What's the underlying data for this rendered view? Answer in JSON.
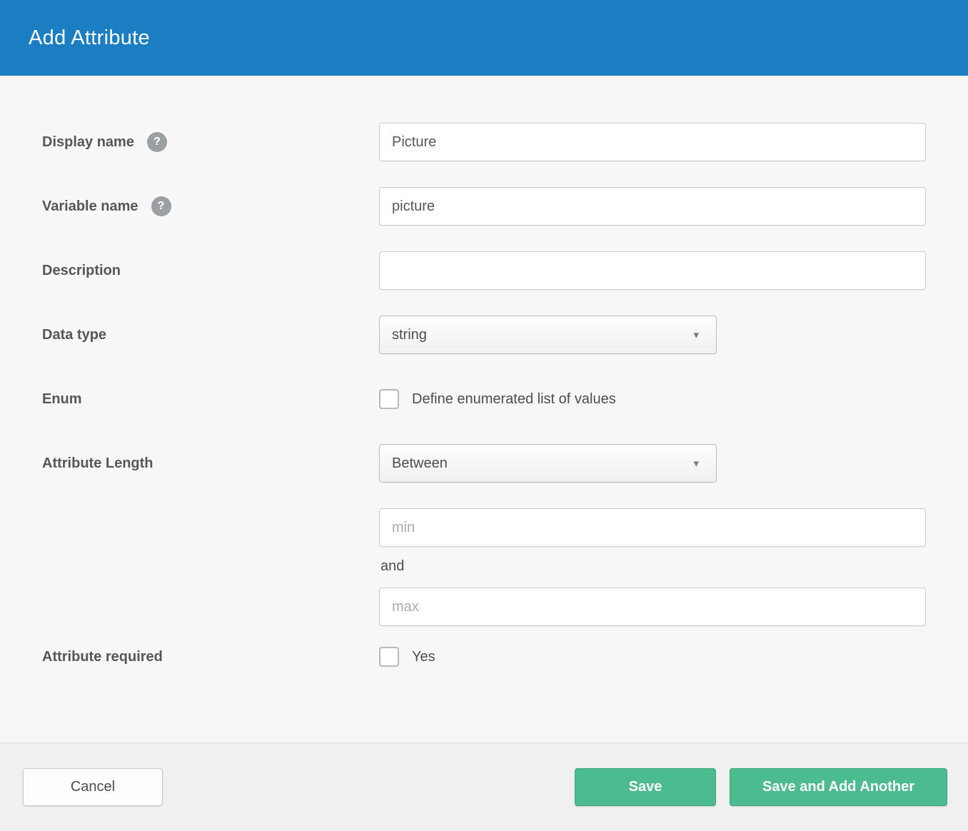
{
  "dialog": {
    "title": "Add Attribute"
  },
  "icons": {
    "help_glyph": "?",
    "caret_glyph": "▾"
  },
  "form": {
    "display_name": {
      "label": "Display name",
      "value": "Picture"
    },
    "variable_name": {
      "label": "Variable name",
      "value": "picture"
    },
    "description": {
      "label": "Description",
      "value": ""
    },
    "data_type": {
      "label": "Data type",
      "selected_option": "string"
    },
    "enum": {
      "label": "Enum",
      "option_label": "Define enumerated list of values",
      "checked": false
    },
    "attribute_length": {
      "label": "Attribute Length",
      "selected_option": "Between",
      "min_placeholder": "min",
      "connector_text": "and",
      "max_placeholder": "max"
    },
    "attribute_required": {
      "label": "Attribute required",
      "option_label": "Yes",
      "checked": false
    }
  },
  "footer": {
    "cancel_label": "Cancel",
    "save_label": "Save",
    "save_and_add_label": "Save and Add Another"
  },
  "colors": {
    "header_bg": "#1b7dc2",
    "body_bg": "#f7f7f7",
    "footer_bg": "#f0f0f0",
    "primary_button": "#4cbb90",
    "primary_button_border": "#3fa77f",
    "label_text": "#55575a",
    "input_border": "#cbcbcb",
    "help_icon_bg": "#9da0a3"
  }
}
